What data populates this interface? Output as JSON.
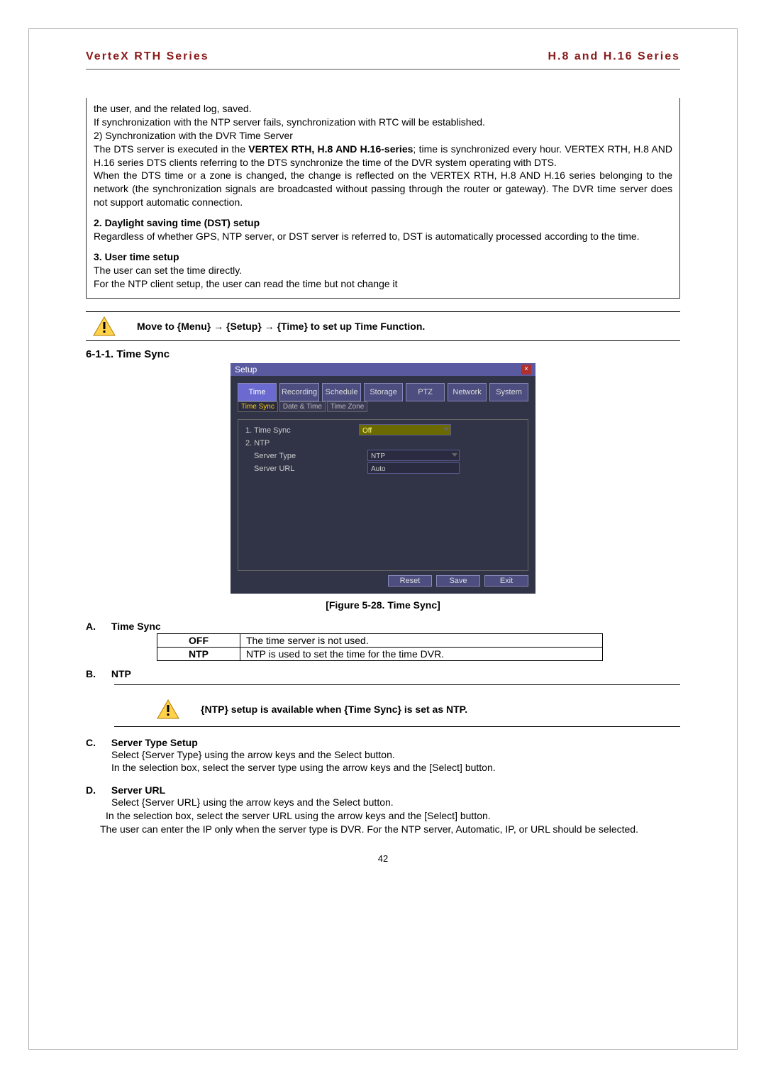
{
  "header": {
    "left": "VerteX RTH Series",
    "right": "H.8 and H.16 Series"
  },
  "box": {
    "l1": "the user, and the related log, saved.",
    "l2": "If synchronization with the NTP server fails, synchronization with RTC will be established.",
    "l3": "2) Synchronization with the DVR Time Server",
    "l4a": "The DTS server is executed in the ",
    "l4b": "VERTEX RTH, H.8 AND H.16-series",
    "l4c": "; time is synchronized every hour. VERTEX RTH, H.8 AND H.16 series DTS clients referring to the DTS synchronize the time of the DVR system operating with DTS.",
    "l5": "When the DTS time or a zone is changed, the change is reflected on the VERTEX RTH, H.8 AND H.16 series belonging to the network (the synchronization signals are broadcasted without passing through the router or gateway). The DVR time server does not support automatic connection.",
    "h2": "2. Daylight saving time (DST) setup",
    "p2": "Regardless of whether GPS, NTP server, or DST server is referred to, DST is automatically processed according to the time.",
    "h3": "3. User time setup",
    "p3a": "The user can set the time directly.",
    "p3b": "For the NTP client setup, the user can read the time but not change it"
  },
  "callout1": "Move to {Menu} → {Setup} → {Time} to set up Time Function.",
  "section611": "6-1-1.  Time Sync",
  "screenshot": {
    "title": "Setup",
    "tabs": [
      "Time",
      "Recording",
      "Schedule",
      "Storage",
      "PTZ",
      "Network",
      "System"
    ],
    "subtabs": [
      "Time Sync",
      "Date & Time",
      "Time Zone"
    ],
    "rows": {
      "r1l": "1. Time Sync",
      "r1v": "Off",
      "r2l": "2. NTP",
      "r3l": "Server Type",
      "r3v": "NTP",
      "r4l": "Server URL",
      "r4v": "Auto"
    },
    "buttons": [
      "Reset",
      "Save",
      "Exit"
    ]
  },
  "figcap": "[Figure 5-28. Time Sync]",
  "secA": {
    "head": "Time Sync",
    "rows": [
      {
        "k": "OFF",
        "v": "The time server is not used."
      },
      {
        "k": "NTP",
        "v": "NTP is used to set the time for the time DVR."
      }
    ]
  },
  "secB": {
    "head": "NTP"
  },
  "callout2": "{NTP} setup is available when {Time Sync} is set as NTP.",
  "secC": {
    "head": "Server Type Setup",
    "p1": "Select {Server Type} using the arrow keys and the Select button.",
    "p2": "In the selection box, select the server type using the arrow keys and the [Select] button."
  },
  "secD": {
    "head": "Server URL",
    "p1": "Select {Server URL} using the arrow keys and the Select button.",
    "p2": " In the selection box, select the server URL using the arrow keys and the [Select] button.",
    "p3": "The user can enter the IP only when the server type is DVR. For the NTP server, Automatic, IP, or URL should be selected."
  },
  "pageNumber": "42",
  "labels": {
    "letA": "A.",
    "letB": "B.",
    "letC": "C.",
    "letD": "D."
  }
}
